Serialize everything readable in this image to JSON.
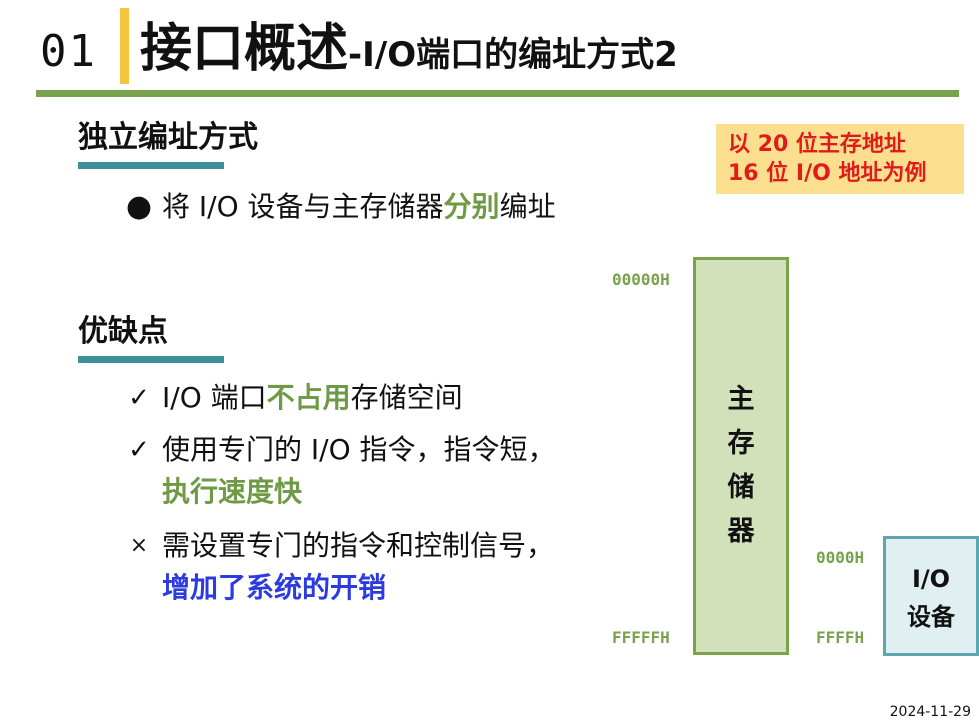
{
  "header": {
    "number": "01",
    "title_main": "接口概述",
    "title_sub": "-I/O端口的编址方式2"
  },
  "section1": {
    "heading": "独立编址方式",
    "bullet": {
      "pre": "将 I/O 设备与主存储器",
      "em": "分别",
      "post": "编址"
    }
  },
  "section2": {
    "heading": "优缺点",
    "items": [
      {
        "mark": "✓",
        "pre": "I/O 端口",
        "em": "不占用",
        "post": "存储空间"
      },
      {
        "mark": "✓",
        "pre": "使用专门的 I/O 指令，指令短，",
        "em": "执行速度快",
        "post": ""
      },
      {
        "mark": "×",
        "pre": "需设置专门的指令和控制信号，",
        "em": "增加了系统的开销",
        "post": ""
      }
    ]
  },
  "note": {
    "line1": "以 20 位主存地址",
    "line2": "16 位 I/O 地址为例",
    "color": "#e11b1b"
  },
  "diagram": {
    "mem_start": "00000H",
    "mem_end": "FFFFFH",
    "mem_label": [
      "主",
      "存",
      "储",
      "器"
    ],
    "io_start": "0000H",
    "io_end": "FFFFH",
    "io_label": [
      "I/O",
      "设备"
    ]
  },
  "footer": {
    "date": "2024-11-29"
  },
  "colors": {
    "accent_green": "#6f9a45",
    "accent_blue": "#2c3be0",
    "teal": "#3f8f99",
    "yellow": "#f4c63d"
  }
}
